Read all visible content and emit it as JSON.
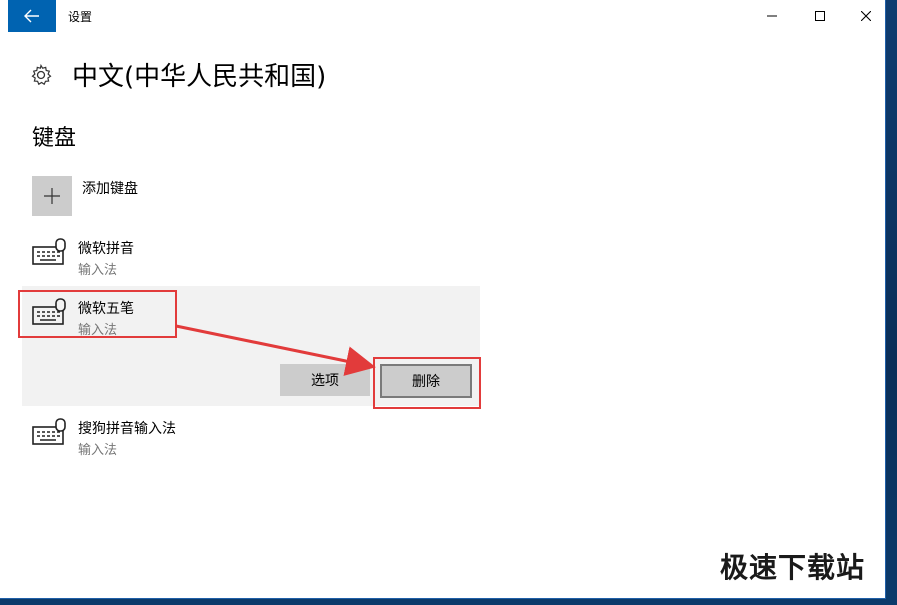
{
  "window": {
    "app_title": "设置"
  },
  "header": {
    "icon": "gear-icon",
    "title": "中文(中华人民共和国)"
  },
  "section": {
    "title": "键盘"
  },
  "add_keyboard": {
    "icon": "plus-icon",
    "label": "添加键盘"
  },
  "keyboards": [
    {
      "name": "微软拼音",
      "type": "输入法"
    },
    {
      "name": "微软五笔",
      "type": "输入法",
      "selected": true
    },
    {
      "name": "搜狗拼音输入法",
      "type": "输入法"
    }
  ],
  "actions": {
    "options_label": "选项",
    "delete_label": "删除"
  },
  "watermark": "极速下载站",
  "colors": {
    "accent": "#0063b1",
    "highlight": "#e23b3b",
    "button": "#cccccc",
    "selected_bg": "#f2f2f2"
  }
}
